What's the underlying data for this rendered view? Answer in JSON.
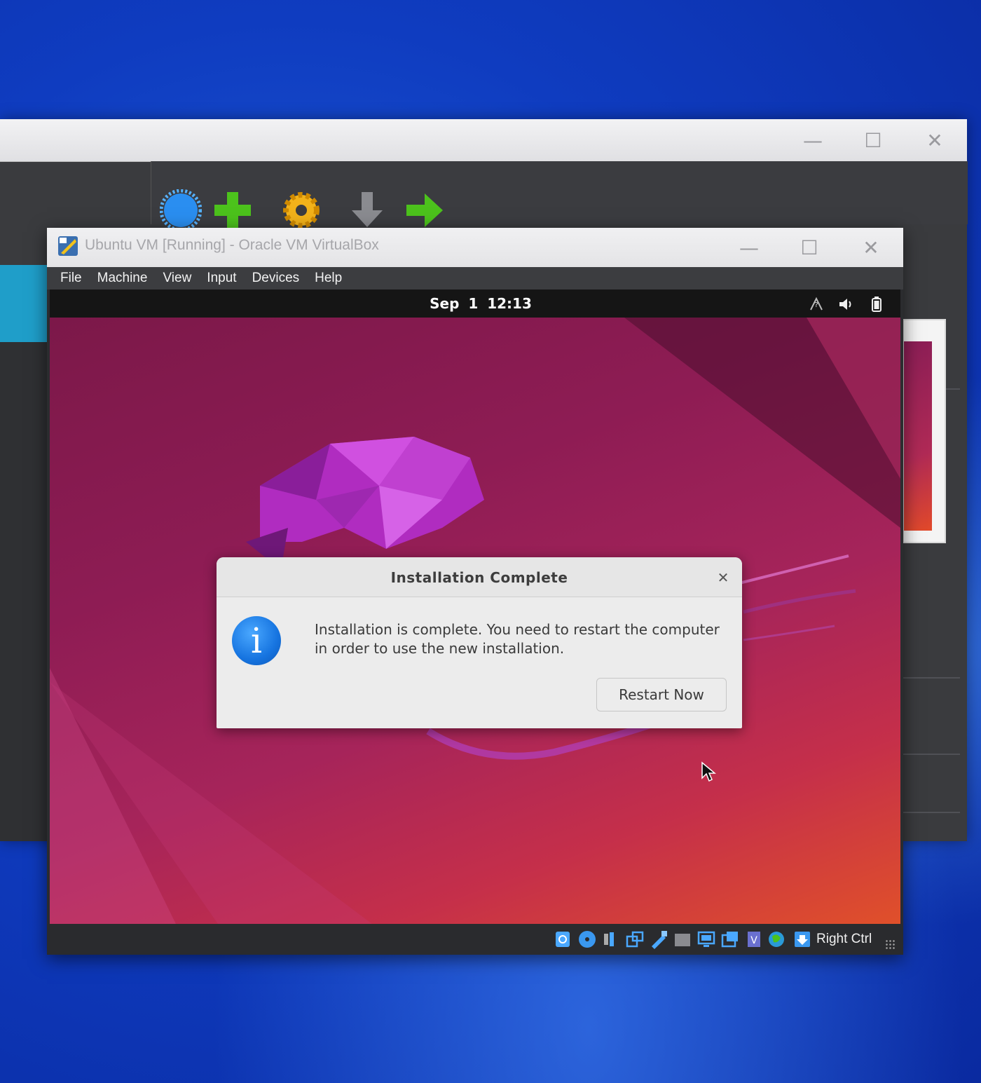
{
  "vm_window": {
    "title": "Ubuntu VM [Running] - Oracle VM VirtualBox",
    "menu": [
      "File",
      "Machine",
      "View",
      "Input",
      "Devices",
      "Help"
    ]
  },
  "guest": {
    "clock": "Sep 1  12:13",
    "tray_icons": [
      "network-icon",
      "volume-icon",
      "battery-icon"
    ]
  },
  "dialog": {
    "title": "Installation Complete",
    "message": "Installation is complete. You need to restart the computer in order to use the new installation.",
    "button_label": "Restart Now",
    "close_glyph": "✕",
    "info_glyph": "i"
  },
  "statusbar": {
    "host_key": "Right Ctrl"
  },
  "colors": {
    "ubuntu_wallpaper": "#8e1c54",
    "info_blue": "#1674e0",
    "desktop_blue": "#0f3cc0"
  }
}
